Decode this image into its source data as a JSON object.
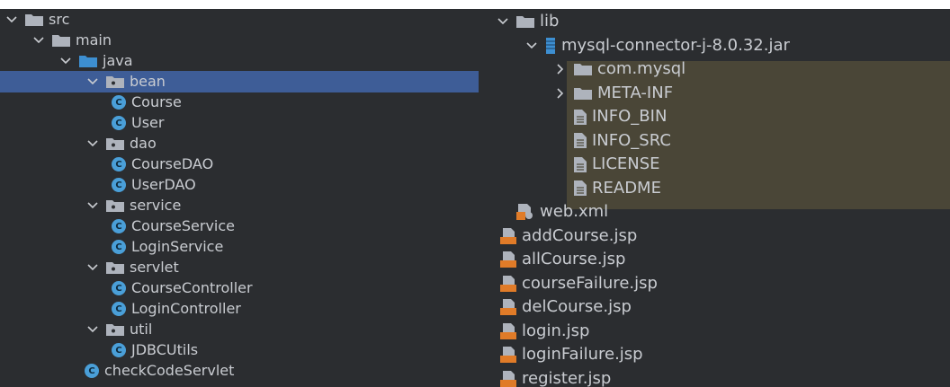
{
  "left_tree": [
    {
      "label": "src",
      "icon": "folder-icon",
      "expanded": true,
      "indent": 0
    },
    {
      "label": "main",
      "icon": "folder-icon",
      "expanded": true,
      "indent": 1
    },
    {
      "label": "java",
      "icon": "source-folder-icon",
      "expanded": true,
      "indent": 2
    },
    {
      "label": "bean",
      "icon": "package-icon",
      "expanded": true,
      "indent": 3,
      "selected": true
    },
    {
      "label": "Course",
      "icon": "class-icon",
      "indent": 4
    },
    {
      "label": "User",
      "icon": "class-icon",
      "indent": 4
    },
    {
      "label": "dao",
      "icon": "package-icon",
      "expanded": true,
      "indent": 3
    },
    {
      "label": "CourseDAO",
      "icon": "class-icon",
      "indent": 4
    },
    {
      "label": "UserDAO",
      "icon": "class-icon",
      "indent": 4
    },
    {
      "label": "service",
      "icon": "package-icon",
      "expanded": true,
      "indent": 3
    },
    {
      "label": "CourseService",
      "icon": "class-icon",
      "indent": 4
    },
    {
      "label": "LoginService",
      "icon": "class-icon",
      "indent": 4
    },
    {
      "label": "servlet",
      "icon": "package-icon",
      "expanded": true,
      "indent": 3
    },
    {
      "label": "CourseController",
      "icon": "class-icon",
      "indent": 4
    },
    {
      "label": "LoginController",
      "icon": "class-icon",
      "indent": 4
    },
    {
      "label": "util",
      "icon": "package-icon",
      "expanded": true,
      "indent": 3
    },
    {
      "label": "JDBCUtils",
      "icon": "class-icon",
      "indent": 4
    },
    {
      "label": "checkCodeServlet",
      "icon": "class-icon",
      "indent": 3
    }
  ],
  "right_tree": [
    {
      "label": "lib",
      "icon": "folder-icon",
      "expanded": true,
      "indent": 0
    },
    {
      "label": "mysql-connector-j-8.0.32.jar",
      "icon": "jar-icon",
      "expanded": true,
      "indent": 1
    },
    {
      "label": "com.mysql",
      "icon": "folder-icon",
      "expanded": false,
      "indent": 2,
      "highlight": true
    },
    {
      "label": "META-INF",
      "icon": "folder-icon",
      "expanded": false,
      "indent": 2,
      "highlight": true
    },
    {
      "label": "INFO_BIN",
      "icon": "text-file-icon",
      "indent": 2,
      "highlight": true
    },
    {
      "label": "INFO_SRC",
      "icon": "text-file-icon",
      "indent": 2,
      "highlight": true
    },
    {
      "label": "LICENSE",
      "icon": "text-file-icon",
      "indent": 2,
      "highlight": true
    },
    {
      "label": "README",
      "icon": "text-file-icon",
      "indent": 2,
      "highlight": true
    },
    {
      "label": "web.xml",
      "icon": "xml-file-icon",
      "indent": 0
    },
    {
      "label": "addCourse.jsp",
      "icon": "jsp-file-icon",
      "indent": -1
    },
    {
      "label": "allCourse.jsp",
      "icon": "jsp-file-icon",
      "indent": -1
    },
    {
      "label": "courseFailure.jsp",
      "icon": "jsp-file-icon",
      "indent": -1
    },
    {
      "label": "delCourse.jsp",
      "icon": "jsp-file-icon",
      "indent": -1
    },
    {
      "label": "login.jsp",
      "icon": "jsp-file-icon",
      "indent": -1
    },
    {
      "label": "loginFailure.jsp",
      "icon": "jsp-file-icon",
      "indent": -1
    },
    {
      "label": "register.jsp",
      "icon": "jsp-file-icon",
      "indent": -1
    }
  ],
  "colors": {
    "background": "#2b2d30",
    "selection": "#3e5d97",
    "jar_highlight": "#4a4637",
    "class_icon": "#4a9fd8",
    "folder": "#aeb3bc",
    "source_folder": "#3d8fd1",
    "jsp_orange": "#e07b28"
  }
}
